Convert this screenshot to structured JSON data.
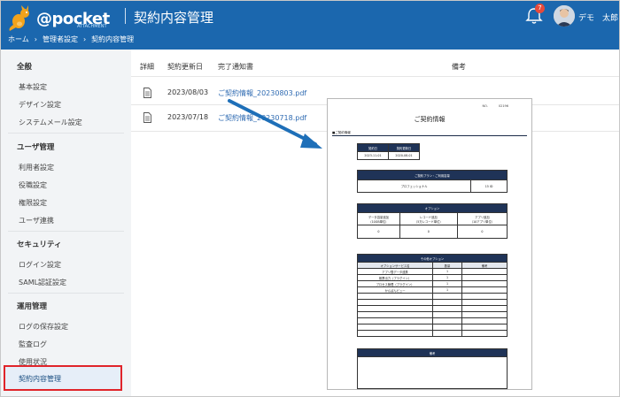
{
  "header": {
    "logo_text": "@pocket",
    "logo_sub": "ATTACHMENT",
    "page_title": "契約内容管理",
    "notification_count": "7",
    "user_name": "デモ　太郎"
  },
  "breadcrumb": [
    "ホーム",
    "管理者設定",
    "契約内容管理"
  ],
  "sidebar": {
    "sections": [
      {
        "heading": "全般",
        "items": [
          "基本設定",
          "デザイン設定",
          "システムメール設定"
        ]
      },
      {
        "heading": "ユーザ管理",
        "items": [
          "利用者設定",
          "役職設定",
          "権限設定",
          "ユーザ連携"
        ]
      },
      {
        "heading": "セキュリティ",
        "items": [
          "ログイン設定",
          "SAML認証設定"
        ]
      },
      {
        "heading": "運用管理",
        "items": [
          "ログの保存設定",
          "監査ログ",
          "使用状況",
          "契約内容管理"
        ]
      }
    ],
    "active_item": "契約内容管理"
  },
  "table": {
    "columns": [
      "詳細",
      "契約更新日",
      "完了通知書",
      "備考"
    ],
    "rows": [
      {
        "date": "2023/08/03",
        "file": "ご契約情報_20230803.pdf"
      },
      {
        "date": "2023/07/18",
        "file": "ご契約情報_20230718.pdf"
      }
    ]
  },
  "pdf_preview": {
    "no_label": "NO.",
    "no_value": "02196",
    "title": "ご契約情報",
    "section": "■ご契約情報",
    "period": {
      "headers": [
        "契約日",
        "契約更新日"
      ],
      "values": [
        "2023-11-01",
        "2020-08-01"
      ]
    },
    "plan": {
      "header": "ご契約プラン・ご利用容量",
      "plan": "プロフェッショナル",
      "capacity": "15 ID"
    },
    "option": {
      "header": "オプション",
      "cols": [
        "データ容量追加",
        "レコード追加",
        "アプリ追加"
      ],
      "subs": [
        "（10GB単位）",
        "（5万レコード単位）",
        "（10アプリ単位）"
      ],
      "values": [
        "0",
        "0",
        "0"
      ]
    },
    "other_option": {
      "header": "その他オプション",
      "cols": [
        "オプションサービス名",
        "数量",
        "備考"
      ],
      "rows": [
        [
          "アプリ間データ連携",
          "1",
          ""
        ],
        [
          "帳票出力（プラグイン）",
          "1",
          ""
        ],
        [
          "プロセス管理（プラグイン）",
          "1",
          ""
        ],
        [
          "かんばんビュー",
          "1",
          ""
        ]
      ]
    },
    "remarks_header": "備考"
  },
  "colors": {
    "header": "#1b67ae",
    "highlight": "#e0242a",
    "arrow": "#1e6fb8",
    "pdf_header": "#1f3357"
  }
}
